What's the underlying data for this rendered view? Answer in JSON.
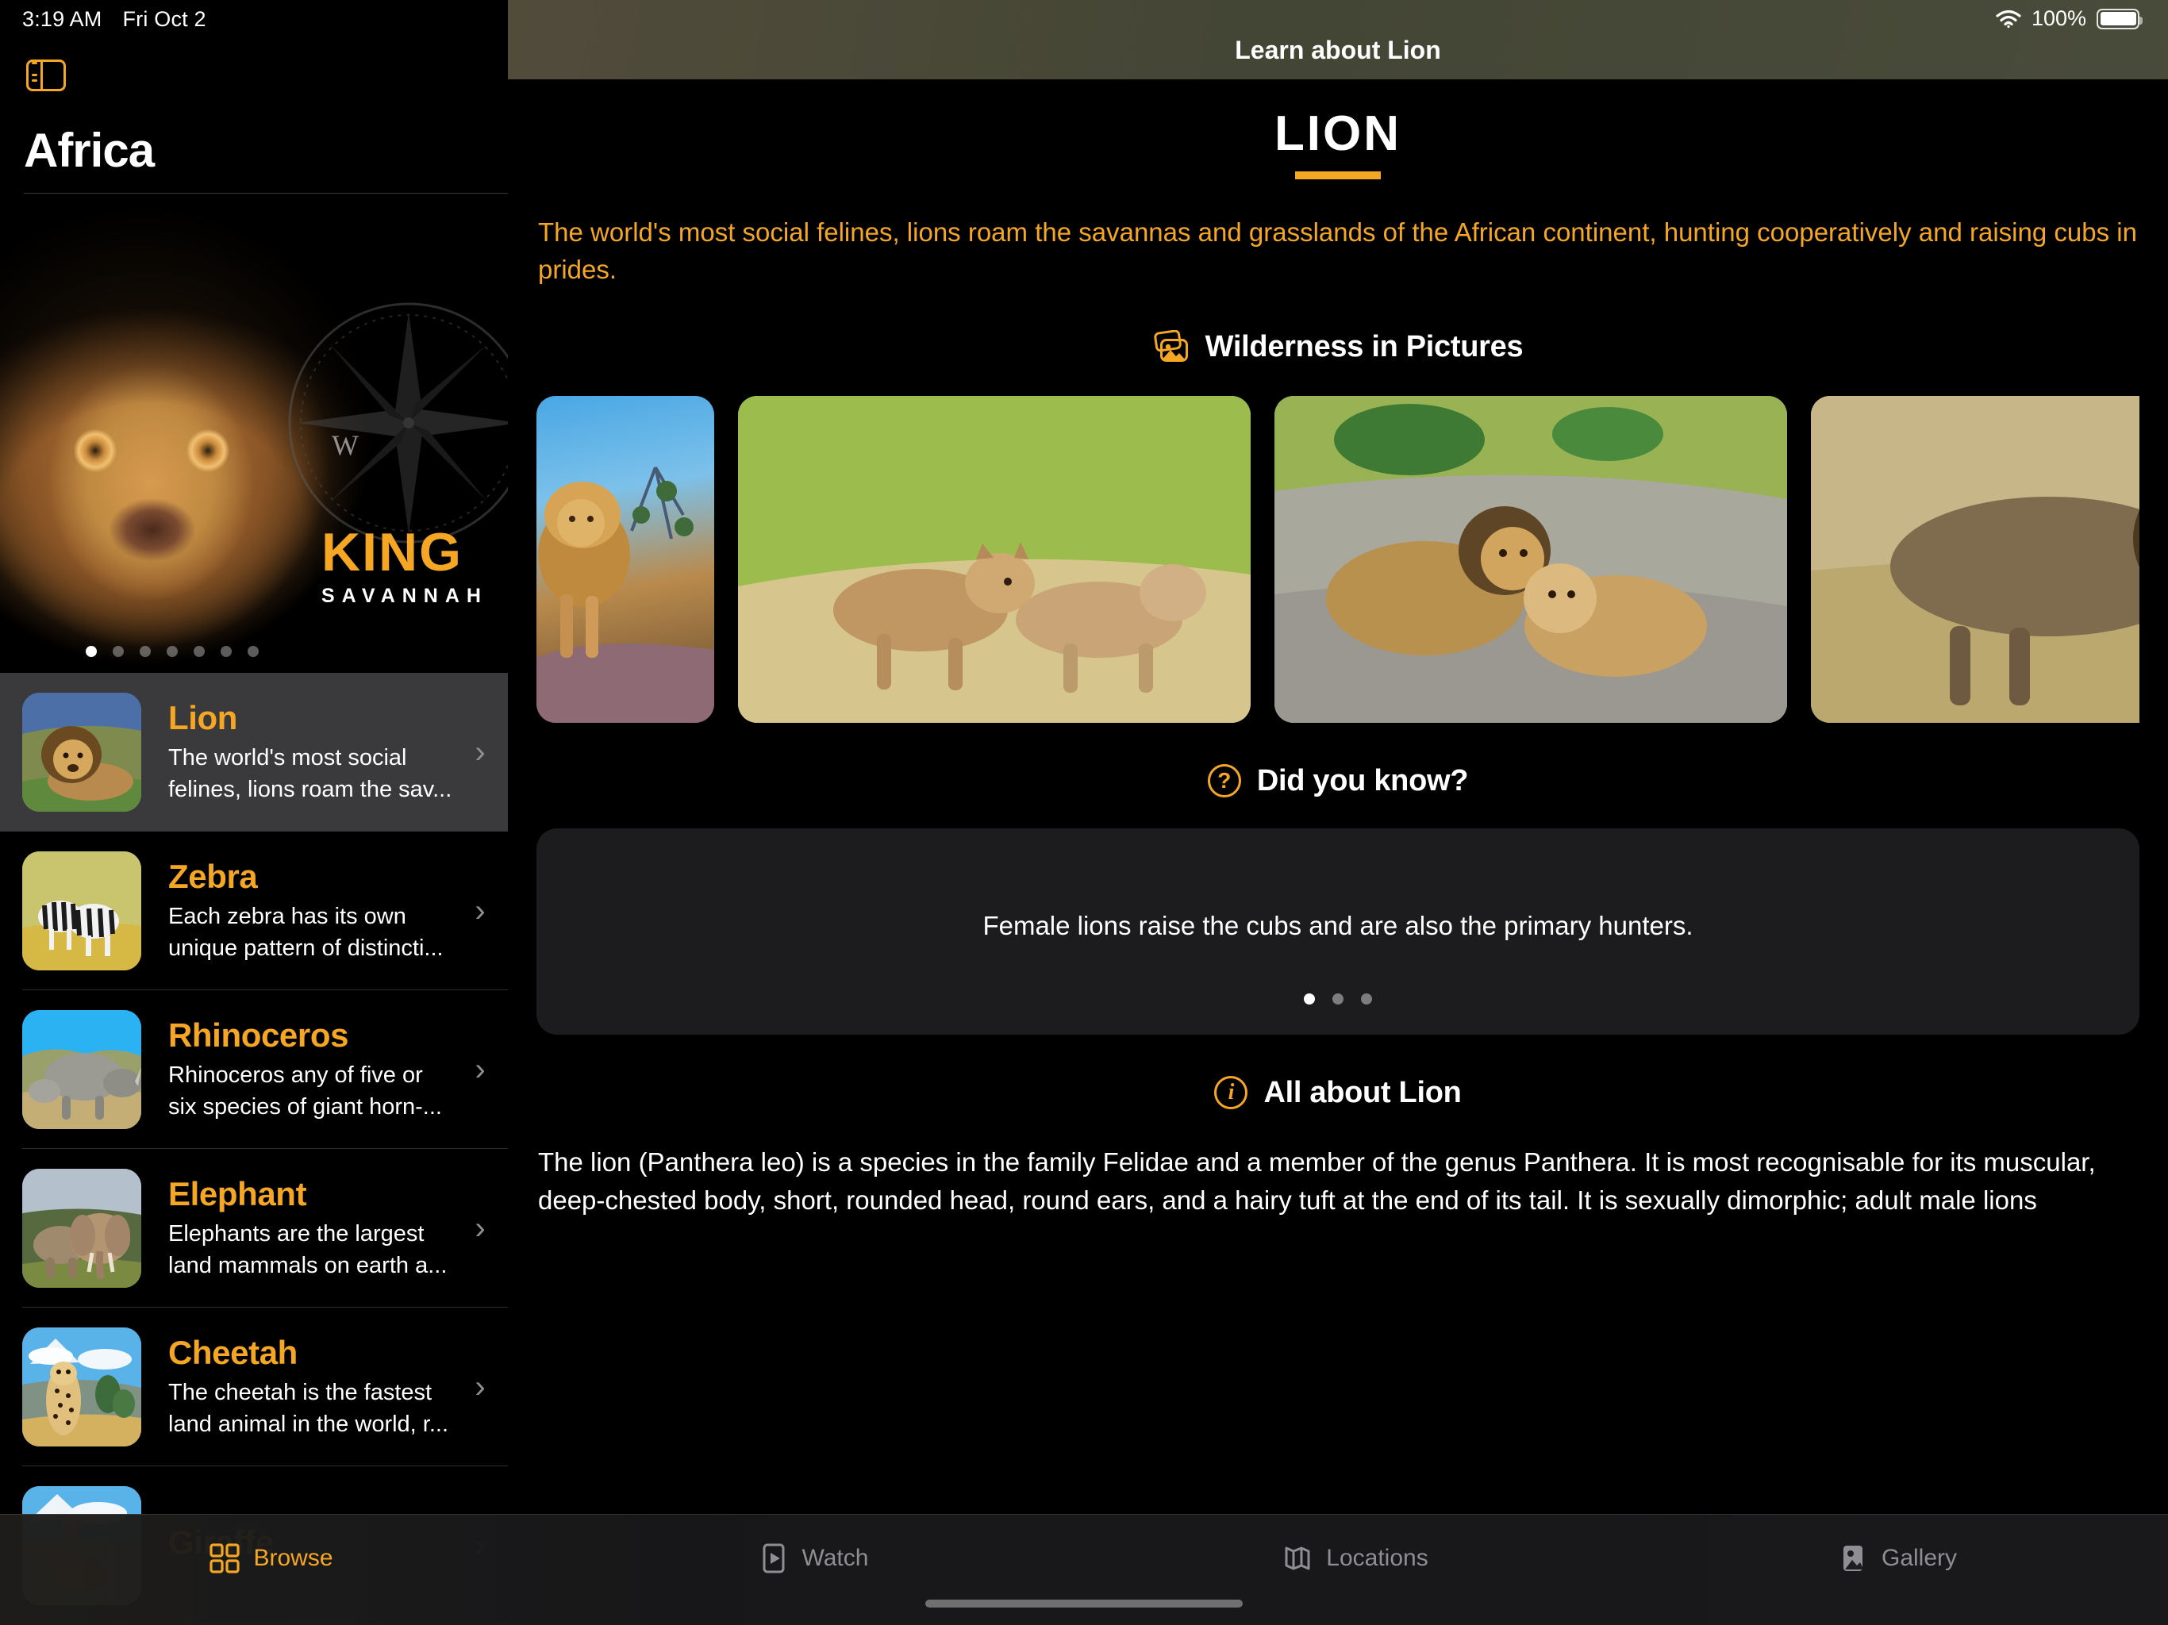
{
  "status_bar": {
    "time": "3:19 AM",
    "date": "Fri Oct 2",
    "battery_percent": "100%",
    "wifi_icon": "wifi-icon",
    "battery_icon": "battery-full-icon"
  },
  "sidebar": {
    "toggle_icon": "sidebar-toggle-icon",
    "title": "Africa",
    "hero": {
      "headline": "KING",
      "subhead": "SAVANNAH",
      "watermark": "W",
      "page_count": 7,
      "active_page": 1
    },
    "items": [
      {
        "name": "Lion",
        "description": "The world's most social felines, lions roam the sav...",
        "selected": true,
        "thumb_class": "t-lion",
        "chevron": "›"
      },
      {
        "name": "Zebra",
        "description": "Each zebra has its own unique pattern of distincti...",
        "selected": false,
        "thumb_class": "t-zebra",
        "chevron": "›"
      },
      {
        "name": "Rhinoceros",
        "description": "Rhinoceros any of five or six species of giant horn-...",
        "selected": false,
        "thumb_class": "t-rhino",
        "chevron": "›"
      },
      {
        "name": "Elephant",
        "description": "Elephants are the largest land mammals on earth a...",
        "selected": false,
        "thumb_class": "t-eleph",
        "chevron": "›"
      },
      {
        "name": "Cheetah",
        "description": "The cheetah is the fastest land animal in the world, r...",
        "selected": false,
        "thumb_class": "t-cheet",
        "chevron": "›"
      },
      {
        "name": "Giraffe",
        "description": "",
        "selected": false,
        "thumb_class": "t-giraf",
        "chevron": "›"
      }
    ]
  },
  "detail": {
    "navbar_title": "Learn about Lion",
    "page_title": "LION",
    "lead": "The world's most social felines, lions roam the savannas and grasslands of the African continent, hunting cooperatively and raising cubs in prides.",
    "pictures_section": {
      "icon": "photo-stack-icon",
      "label": "Wilderness in Pictures",
      "images": [
        {
          "caption": "lion walking on rock under blue sky",
          "class": "g1"
        },
        {
          "caption": "two lion cubs walking through tall grass",
          "class": "g2"
        },
        {
          "caption": "male lion and lioness resting on rocks",
          "class": "g3"
        },
        {
          "caption": "male lion walking through dry savanna grass",
          "class": "g4"
        }
      ]
    },
    "did_you_know": {
      "icon": "question-circle-icon",
      "label": "Did you know?",
      "fact": "Female lions raise the cubs and are also the primary hunters.",
      "page_count": 3,
      "active_page": 1
    },
    "all_about": {
      "icon": "info-circle-icon",
      "label": "All about Lion",
      "body": "The lion (Panthera leo) is a species in the family Felidae and a member of the genus Panthera. It is most recognisable for its muscular, deep-chested body, short, rounded head, round ears, and a hairy tuft at the end of its tail. It is sexually dimorphic; adult male lions"
    }
  },
  "tabbar": {
    "items": [
      {
        "label": "Browse",
        "icon": "grid-squares-icon",
        "active": true
      },
      {
        "label": "Watch",
        "icon": "play-rectangle-icon",
        "active": false
      },
      {
        "label": "Locations",
        "icon": "map-icon",
        "active": false
      },
      {
        "label": "Gallery",
        "icon": "photo-icon",
        "active": false
      }
    ]
  },
  "colors": {
    "accent": "#F5A623",
    "background": "#000000",
    "card": "#1C1C1E",
    "selected_row": "#3A3A3C",
    "navbar": "#4E503E"
  }
}
